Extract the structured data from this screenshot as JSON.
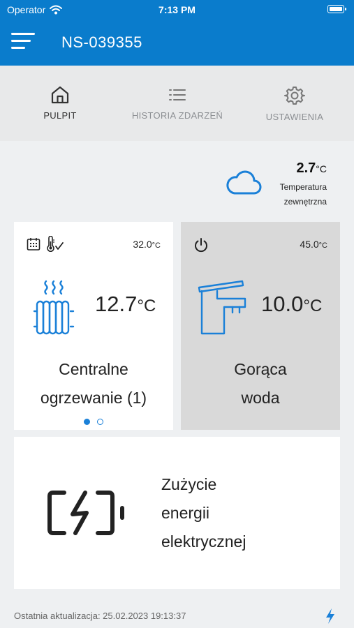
{
  "status_bar": {
    "carrier": "Operator",
    "time": "7:13 PM"
  },
  "header": {
    "title": "NS-039355",
    "menu_icon": "hamburger-menu-icon"
  },
  "tabs": [
    {
      "label": "PULPIT",
      "icon": "home-icon",
      "active": true
    },
    {
      "label": "HISTORIA ZDARZEŃ",
      "icon": "list-icon",
      "active": false
    },
    {
      "label": "USTAWIENIA",
      "icon": "gear-icon",
      "active": false
    }
  ],
  "weather": {
    "temp": "2.7",
    "unit": "°C",
    "label_line1": "Temperatura",
    "label_line2": "zewnętrzna",
    "icon": "cloud-icon"
  },
  "central_heating": {
    "set_temp": "32.0",
    "set_unit": "°C",
    "current_temp": "12.7",
    "current_unit": "°C",
    "name_line1": "Centralne",
    "name_line2": "ogrzewanie (1)",
    "icons": [
      "calendar-icon",
      "thermometer-check-icon",
      "radiator-icon"
    ],
    "page_dots": {
      "count": 2,
      "active": 1
    }
  },
  "hot_water": {
    "set_temp": "45.0",
    "set_unit": "°C",
    "current_temp": "10.0",
    "current_unit": "°C",
    "name_line1": "Gorąca",
    "name_line2": "woda",
    "icons": [
      "power-icon",
      "faucet-icon"
    ]
  },
  "energy": {
    "line1": "Zużycie",
    "line2": "energii",
    "line3": "elektrycznej",
    "icon": "battery-charging-icon"
  },
  "footer": {
    "last_update": "Ostatnia aktualizacja: 25.02.2023 19:13:37",
    "icon": "lightning-icon"
  },
  "colors": {
    "accent": "#0a7ccc",
    "icon_blue": "#1a80d8",
    "card_inactive": "#d9d9d9",
    "background": "#eef0f2"
  }
}
